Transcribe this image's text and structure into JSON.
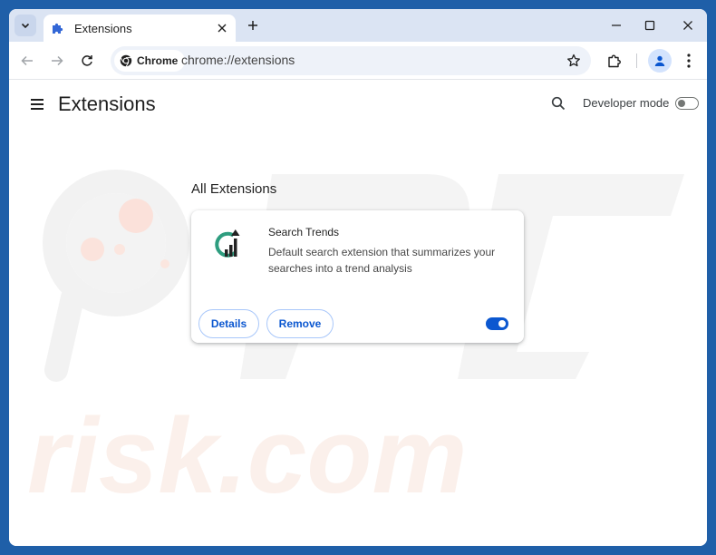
{
  "tab": {
    "title": "Extensions"
  },
  "omnibox": {
    "chip_label": "Chrome",
    "url": "chrome://extensions"
  },
  "page": {
    "title": "Extensions",
    "developer_mode_label": "Developer mode",
    "developer_mode_on": false
  },
  "section": {
    "title": "All Extensions"
  },
  "extension": {
    "name": "Search Trends",
    "description": "Default search extension that summarizes your searches into a trend analysis",
    "details_label": "Details",
    "remove_label": "Remove",
    "enabled": true
  },
  "watermark": {
    "text": "risk.com"
  },
  "colors": {
    "frame": "#1f5fa8",
    "tabstrip": "#dbe4f3",
    "accent": "#0b57d0",
    "icon_green": "#2e9d7f",
    "icon_dark": "#222222"
  },
  "icons": {
    "tab_search": "chevron-down-icon",
    "tab_favicon": "puzzle-piece-icon",
    "tab_close": "close-icon",
    "new_tab": "plus-icon",
    "minimize": "minimize-icon",
    "maximize": "maximize-icon",
    "close_window": "close-icon",
    "back": "arrow-left-icon",
    "forward": "arrow-right-icon",
    "reload": "reload-icon",
    "chrome": "chrome-logo-icon",
    "bookmark": "star-icon",
    "extensions": "puzzle-piece-icon",
    "profile": "person-icon",
    "menu": "kebab-menu-icon",
    "hamburger": "hamburger-menu-icon",
    "search": "search-icon"
  }
}
